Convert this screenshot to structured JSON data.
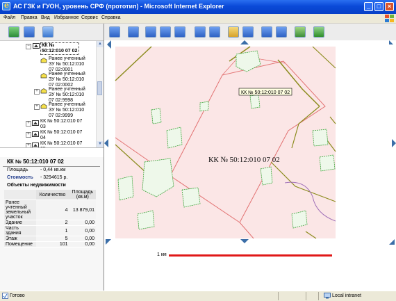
{
  "window": {
    "title": "АС ГЗК и ГУОН, уровень СРФ (прототип) - Microsoft Internet Explorer",
    "minimize": "_",
    "maximize": "□",
    "close": "×"
  },
  "menu": {
    "file": "Файл",
    "edit": "Правка",
    "view": "Вид",
    "favorites": "Избранное",
    "service": "Сервис",
    "help": "Справка"
  },
  "tree": {
    "root": "КК № 50:12:010 07 02",
    "items": [
      {
        "label_l1": "Ранее учтенный",
        "label_l2": "ЗУ № 50:12:010",
        "label_l3": "07 02:0001"
      },
      {
        "label_l1": "Ранее учтенный",
        "label_l2": "ЗУ № 50:12:010",
        "label_l3": "07 02:0002"
      },
      {
        "label_l1": "Ранее учтенный",
        "label_l2": "ЗУ № 50:12:010",
        "label_l3": "07 02:9998"
      },
      {
        "label_l1": "Ранее учтенный",
        "label_l2": "ЗУ № 50:12:010",
        "label_l3": "07 02:9999"
      }
    ],
    "siblings": [
      {
        "l1": "КК № 50:12:010 07",
        "l2": "03"
      },
      {
        "l1": "КК № 50:12:010 07",
        "l2": "04"
      },
      {
        "l1": "КК № 50:12:010 07",
        "l2": "05"
      }
    ]
  },
  "info": {
    "title": "КК № 50:12:010 07 02",
    "area_label": "Площадь",
    "area_value": "- 0,44 кв.км",
    "cost_label": "Стоимость",
    "cost_value": "- 3294615 р.",
    "objects_label": "Объекты недвижимости",
    "col_count": "Количество",
    "col_area": "Площадь (кв.м)",
    "rows": [
      {
        "name": "Ранее учтенный земельный участок",
        "count": "4",
        "area": "13 879,01"
      },
      {
        "name": "Здание",
        "count": "2",
        "area": "0,00"
      },
      {
        "name": "Часть здания",
        "count": "1",
        "area": "0,00"
      },
      {
        "name": "Этаж",
        "count": "5",
        "area": "0,00"
      },
      {
        "name": "Помещение",
        "count": "101",
        "area": "0,00"
      }
    ]
  },
  "map": {
    "tooltip": "КК № 50:12:010 07 02",
    "parcel_label": "КК № 50:12:010 07 02",
    "scale_label": "1 км"
  },
  "status": {
    "left": "Готово",
    "zone": "Local intranet"
  },
  "colors": {
    "title_bar": "#0a4ad8",
    "parcel_fill": "#fbe3e3",
    "parcel_outline": "#e06a6a",
    "building_outline": "#3aa53a",
    "road_color": "#8c8c1e",
    "scale_bar": "#e01818"
  }
}
